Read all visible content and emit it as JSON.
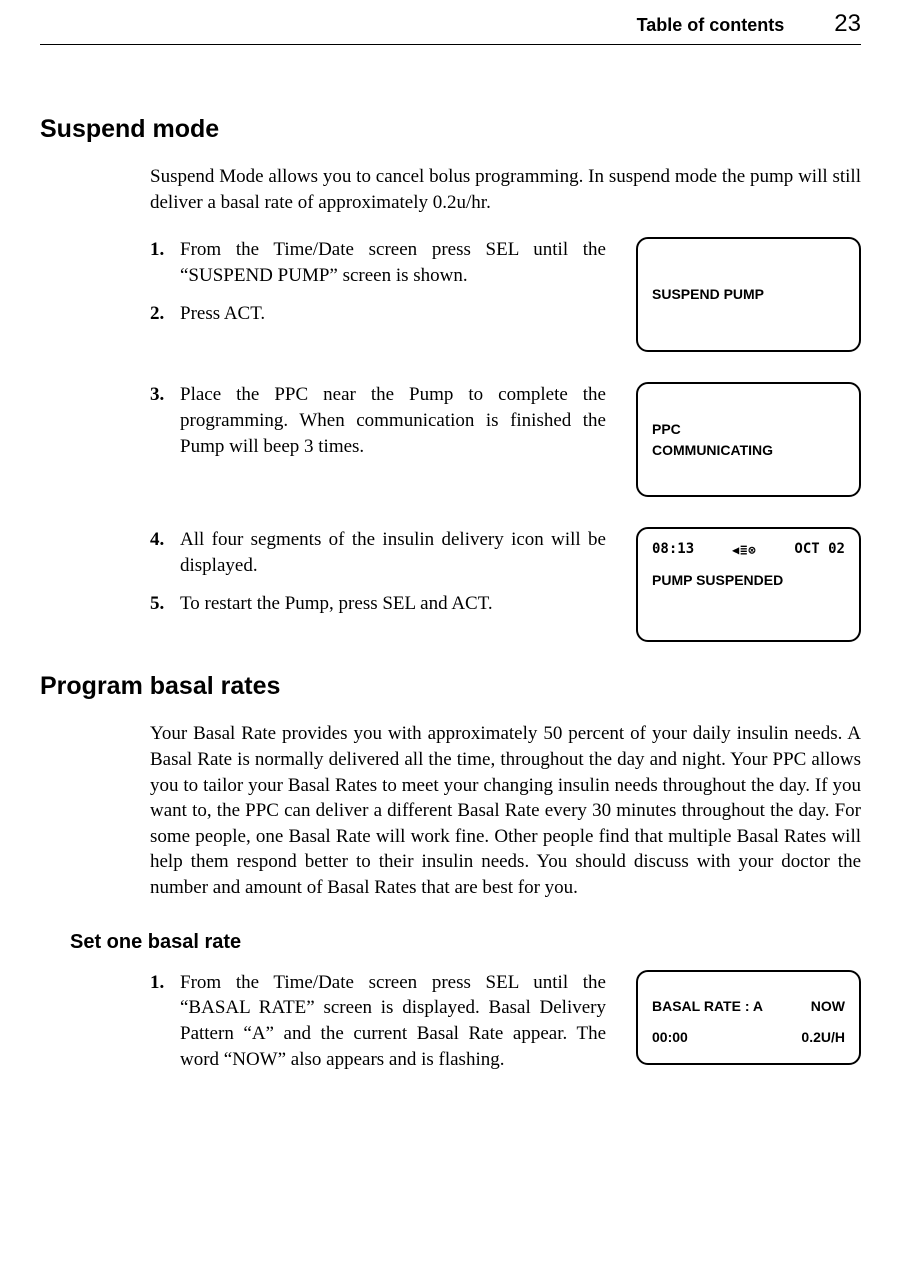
{
  "header": {
    "toc": "Table of contents",
    "page": "23"
  },
  "section1": {
    "title": "Suspend mode",
    "intro": "Suspend Mode allows you to cancel bolus programming. In suspend mode the pump will still deliver a basal rate of approximately 0.2u/hr.",
    "steps": {
      "s1": {
        "n": "1.",
        "t": "From the Time/Date screen press SEL until the “SUSPEND PUMP” screen is shown."
      },
      "s2": {
        "n": "2.",
        "t": "Press ACT."
      },
      "s3": {
        "n": "3.",
        "t": "Place the PPC near the Pump to complete the programming. When communication is finished the Pump will beep 3 times."
      },
      "s4": {
        "n": "4.",
        "t": "All four segments of the insulin delivery icon will be displayed."
      },
      "s5": {
        "n": "5.",
        "t": "To restart the Pump, press SEL and ACT."
      }
    },
    "device1": "SUSPEND PUMP",
    "device2a": "PPC",
    "device2b": "COMMUNICATING",
    "device3_top_time": "08:13",
    "device3_top_icons": "◀≣⊗",
    "device3_top_date": "OCT 02",
    "device3_msg": "PUMP SUSPENDED"
  },
  "section2": {
    "title": "Program basal rates",
    "intro": "Your Basal Rate provides you with approximately 50 percent of your daily insulin needs. A Basal Rate is normally delivered all the time, throughout the day and night. Your PPC allows you to tailor your Basal Rates to meet your changing insulin needs throughout the day. If you want to, the PPC can deliver a different Basal Rate every 30 minutes throughout the day. For some people, one Basal Rate will work fine. Other people find that multiple Basal Rates will help them respond better to their insulin needs. You should discuss with your doctor the number and amount of Basal Rates that are best for you.",
    "sub": "Set one basal rate",
    "steps": {
      "s1": {
        "n": "1.",
        "t": "From the Time/Date screen press SEL until the “BASAL RATE” screen is displayed. Basal Delivery Pattern “A” and the current Basal Rate appear. The word “NOW” also appears and is flashing."
      }
    },
    "device4": {
      "label": "BASAL RATE : A",
      "now": "NOW",
      "time": "00:00",
      "rate": "0.2U/H"
    }
  }
}
